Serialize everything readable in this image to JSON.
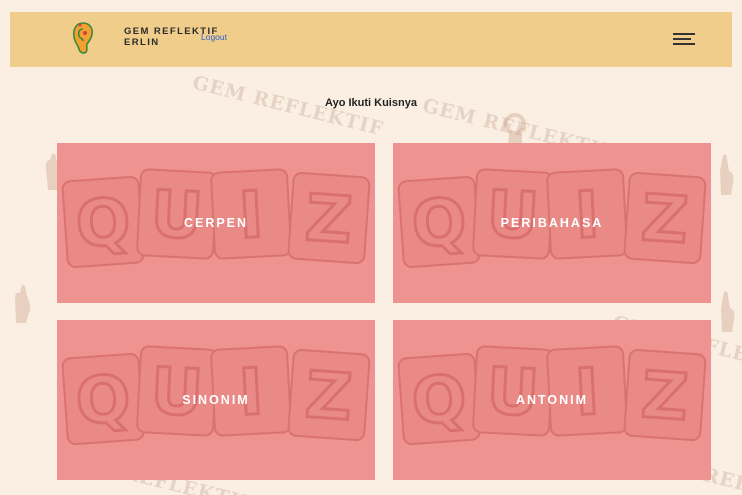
{
  "header": {
    "brand_line1": "GEM REFLEKTIF",
    "brand_line2": "ERLIN",
    "logout_label": "Logout"
  },
  "main": {
    "title": "Ayo Ikuti Kuisnya",
    "quizzes": [
      {
        "label": "CERPEN"
      },
      {
        "label": "PERIBAHASA"
      },
      {
        "label": "SINONIM"
      },
      {
        "label": "ANTONIM"
      }
    ]
  },
  "background": {
    "watermark": "GEM REFLEKTIF"
  },
  "colors": {
    "header_bg": "#f0cd8a",
    "page_bg": "#fbeee2",
    "card_bg": "#ef9390",
    "link": "#2e62c8"
  },
  "icons": [
    "ear-logo-icon",
    "hamburger-menu-icon",
    "quiz-tiles-icon"
  ]
}
